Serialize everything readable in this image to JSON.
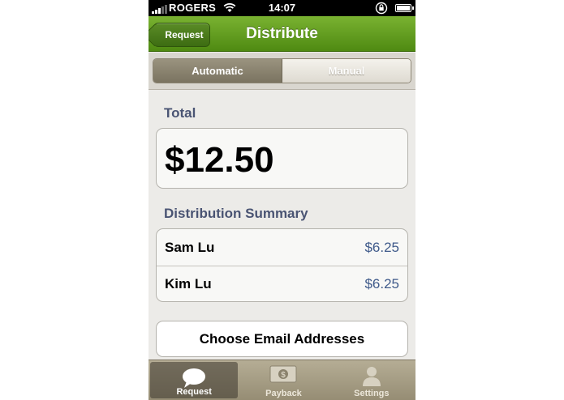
{
  "status_bar": {
    "carrier": "ROGERS",
    "time": "14:07"
  },
  "nav": {
    "back_label": "Request",
    "title": "Distribute"
  },
  "segments": {
    "automatic": "Automatic",
    "manual": "Manual",
    "selected": "Automatic"
  },
  "total": {
    "label": "Total",
    "amount": "$12.50"
  },
  "summary": {
    "label": "Distribution Summary",
    "rows": [
      {
        "name": "Sam Lu",
        "amount": "$6.25"
      },
      {
        "name": "Kim Lu",
        "amount": "$6.25"
      }
    ]
  },
  "actions": {
    "choose_email": "Choose Email Addresses"
  },
  "tabs": [
    {
      "label": "Request",
      "icon": "speech-bubble-icon",
      "active": true
    },
    {
      "label": "Payback",
      "icon": "dollar-bill-icon",
      "active": false
    },
    {
      "label": "Settings",
      "icon": "person-icon",
      "active": false
    }
  ],
  "colors": {
    "nav_green": "#5f9a1c",
    "label_blue": "#4a5473",
    "amount_blue": "#3f5a8a",
    "tab_bar": "#a69e86"
  }
}
